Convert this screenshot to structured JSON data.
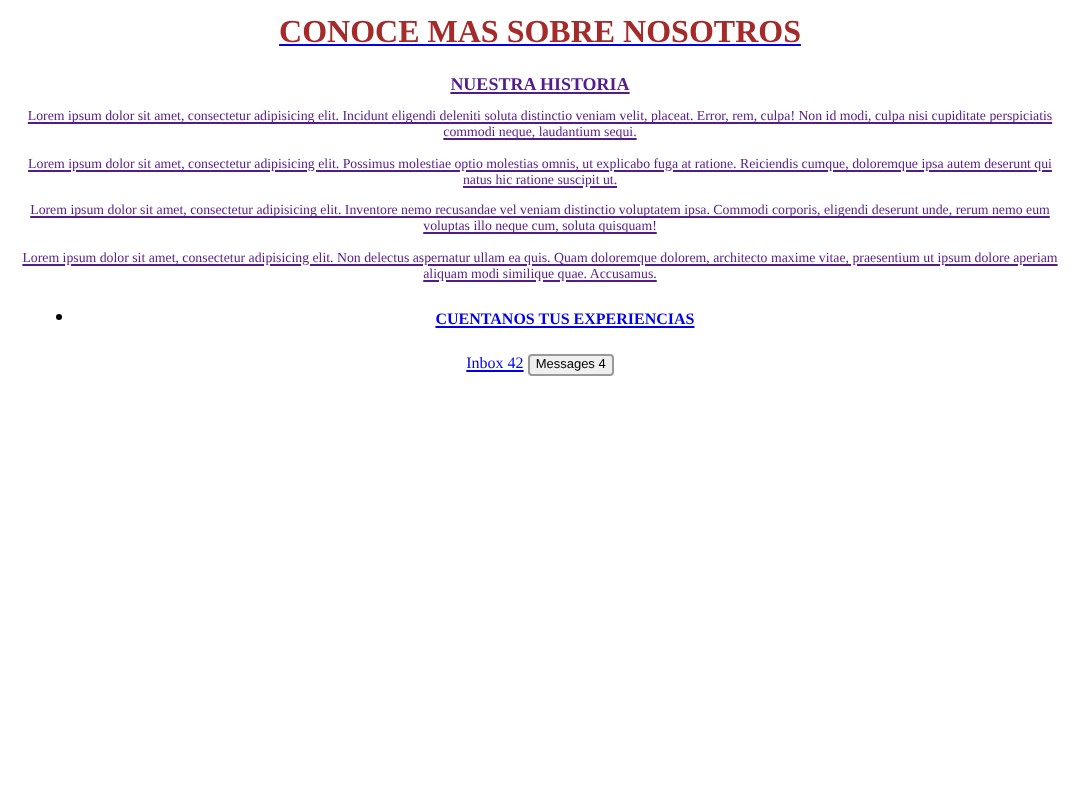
{
  "title": "CONOCE MAS SOBRE NOSOTROS",
  "history": {
    "heading": "NUESTRA HISTORIA",
    "visited": true
  },
  "paragraphs": [
    {
      "text": "Lorem ipsum dolor sit amet, consectetur adipisicing elit. Incidunt eligendi deleniti soluta distinctio veniam velit, placeat. Error, rem, culpa! Non id modi, culpa nisi cupiditate perspiciatis commodi neque, laudantium sequi.",
      "visited": true
    },
    {
      "text": "Lorem ipsum dolor sit amet, consectetur adipisicing elit. Possimus molestiae optio molestias omnis, ut explicabo fuga at ratione. Reiciendis cumque, doloremque ipsa autem deserunt qui natus hic ratione suscipit ut.",
      "visited": true
    },
    {
      "text": "Lorem ipsum dolor sit amet, consectetur adipisicing elit. Inventore nemo recusandae vel veniam distinctio voluptatem ipsa. Commodi corporis, eligendi deserunt unde, rerum nemo eum voluptas illo neque cum, soluta quisquam!",
      "visited": true
    },
    {
      "text": "Lorem ipsum dolor sit amet, consectetur adipisicing elit. Non delectus aspernatur ullam ea quis. Quam doloremque dolorem, architecto maxime vitae, praesentium ut ipsum dolore aperiam aliquam modi similique quae. Accusamus.",
      "visited": true
    }
  ],
  "list_items": [
    {
      "label": "CUENTANOS TUS EXPERIENCIAS",
      "visited": false
    }
  ],
  "inbox_link": {
    "label": "Inbox 42"
  },
  "messages_button": {
    "label": "Messages 4"
  }
}
